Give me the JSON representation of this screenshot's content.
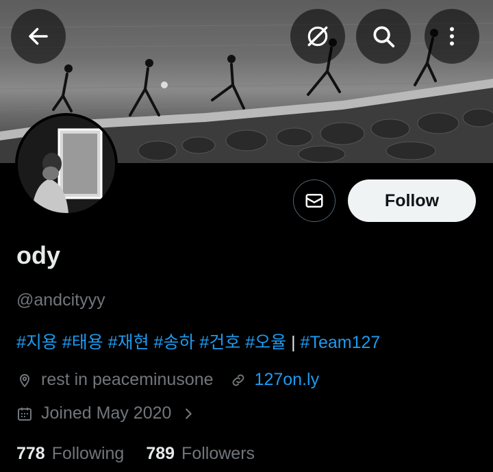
{
  "header": {
    "back_icon": "arrow-left-icon",
    "grok_icon": "grok-icon",
    "search_icon": "search-icon",
    "more_icon": "more-vertical-icon"
  },
  "profile": {
    "name": "ody",
    "handle": "@andcityyy",
    "bio_hashtags": "#지용 #태용 #재현 #송하 #건호 #오율",
    "bio_separator": " | ",
    "bio_team_tag": "#Team127",
    "location": "rest in peaceminusone",
    "website": "127on.ly",
    "joined": "Joined May 2020",
    "following_count": "778",
    "following_label": "Following",
    "followers_count": "789",
    "followers_label": "Followers"
  },
  "actions": {
    "message_icon": "mail-icon",
    "follow_label": "Follow"
  },
  "colors": {
    "background": "#000000",
    "text_primary": "#e7e9ea",
    "text_secondary": "#71767b",
    "accent": "#1d9bf0",
    "follow_bg": "#eff3f4"
  }
}
